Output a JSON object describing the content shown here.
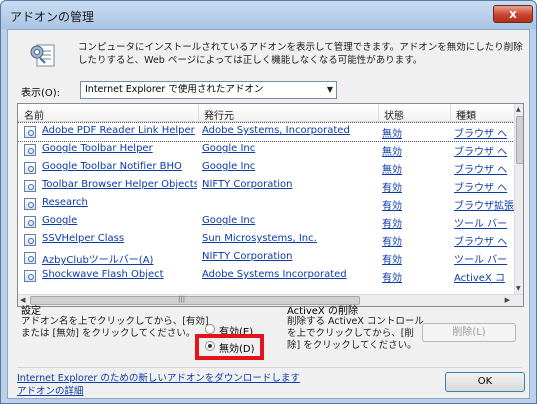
{
  "window": {
    "title": "アドオンの管理",
    "close_glyph": "x"
  },
  "header": {
    "description": "コンピュータにインストールされているアドオンを表示して管理できます。アドオンを無効にしたり削除したりすると、Web ページによっては正しく機能しなくなる可能性があります。",
    "show_label": "表示(O):",
    "show_value": "Internet Explorer で使用されたアドオン"
  },
  "list": {
    "columns": [
      "名前",
      "発行元",
      "状態",
      "種類"
    ],
    "rows": [
      {
        "name": "Adobe PDF Reader Link Helper",
        "publisher": "Adobe Systems, Incorporated",
        "status": "無効",
        "type": "ブラウザ ヘ"
      },
      {
        "name": "Google Toolbar Helper",
        "publisher": "Google Inc",
        "status": "無効",
        "type": "ブラウザ ヘ"
      },
      {
        "name": "Google Toolbar Notifier BHO",
        "publisher": "Google Inc",
        "status": "無効",
        "type": "ブラウザ ヘ"
      },
      {
        "name": "Toolbar Browser Helper Objects",
        "publisher": "NIFTY Corporation",
        "status": "有効",
        "type": "ブラウザ ヘ"
      },
      {
        "name": "Research",
        "publisher": "",
        "status": "有効",
        "type": "ブラウザ拡張"
      },
      {
        "name": "Google",
        "publisher": "Google Inc",
        "status": "有効",
        "type": "ツール バー"
      },
      {
        "name": "SSVHelper Class",
        "publisher": "Sun Microsystems, Inc.",
        "status": "有効",
        "type": "ブラウザ ヘ"
      },
      {
        "name": "AzbyClubツールバー(A)",
        "publisher": "NIFTY Corporation",
        "status": "有効",
        "type": "ツール バー"
      },
      {
        "name": "Shockwave Flash Object",
        "publisher": "Adobe Systems Incorporated",
        "status": "有効",
        "type": "ActiveX コ"
      }
    ]
  },
  "settings": {
    "title": "設定",
    "description": "アドオン名を上でクリックしてから、[有効] または [無効] をクリックしてください。",
    "enable_label": "有効(E)",
    "disable_label": "無効(D)",
    "selected": "disable"
  },
  "activex": {
    "title": "ActiveX の削除",
    "description": "削除する ActiveX コントロールを上でクリックしてから、[削除] をクリックしてください。",
    "delete_label": "削除(L)"
  },
  "footer": {
    "download_link": "Internet Explorer のための新しいアドオンをダウンロードします",
    "details_link": "アドオンの詳細",
    "ok_label": "OK"
  },
  "colors": {
    "link": "#0b3ba8",
    "highlight": "#e3141d",
    "title_bar": "#b9d1ea"
  }
}
